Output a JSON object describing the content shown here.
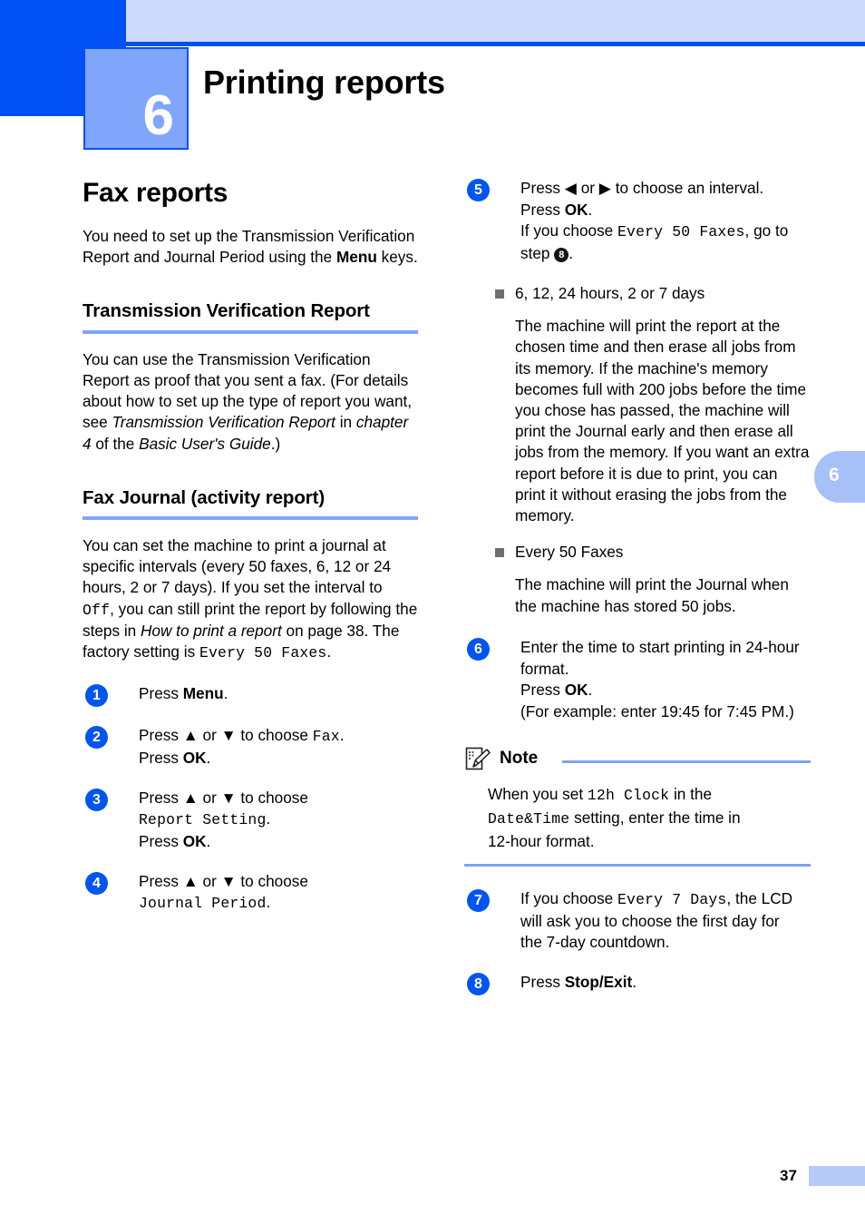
{
  "chapter": {
    "number": "6",
    "title": "Printing reports",
    "edge_tab_number": "6"
  },
  "colors": {
    "header_dark_blue": "#0050f5",
    "header_pale_blue": "#ccdafb",
    "chapter_box_blue": "#80a6fb",
    "rule_blue": "#80a6fb",
    "step_badge_blue": "#0055f0",
    "edge_tab_blue": "#a7c0f7",
    "bullet_gray": "#6e6e6e",
    "footer_block_blue": "#b6cbf8"
  },
  "left_column": {
    "section_title": "Fax reports",
    "intro": {
      "part1": "You need to set up the Transmission Verification Report and Journal Period using the ",
      "bold": "Menu",
      "part2": " keys."
    },
    "sub1_title": "Transmission Verification Report",
    "sub1_body": {
      "part1": "You can use the Transmission Verification Report as proof that you sent a fax. (For details about how to set up the type of report you want, see ",
      "italic1": "Transmission Verification Report",
      "part2": " in ",
      "italic2": "chapter 4",
      "part3": " of the ",
      "italic3": "Basic User's Guide",
      "part4": ".)"
    },
    "sub2_title": "Fax Journal (activity report)",
    "sub2_body": {
      "part1": "You can set the machine to print a journal at specific intervals (every 50 faxes, 6, 12 or 24 hours, 2 or 7 days). If you set the interval to ",
      "mono1": "Off",
      "part2": ", you can still print the report by following the steps in ",
      "italic1": "How to print a report",
      "part3": " on page 38. The factory setting is ",
      "mono2": "Every 50 Faxes",
      "part4": "."
    },
    "steps": [
      {
        "number": "1",
        "lines": [
          {
            "segments": [
              {
                "text": "Press ",
                "style": "normal"
              },
              {
                "text": "Menu",
                "style": "bold"
              },
              {
                "text": ".",
                "style": "normal"
              }
            ]
          }
        ]
      },
      {
        "number": "2",
        "lines": [
          {
            "segments": [
              {
                "text": "Press ",
                "style": "normal"
              },
              {
                "text": "▲",
                "style": "glyph"
              },
              {
                "text": " or ",
                "style": "normal"
              },
              {
                "text": "▼",
                "style": "glyph"
              },
              {
                "text": " to choose ",
                "style": "normal"
              },
              {
                "text": "Fax",
                "style": "mono"
              },
              {
                "text": ".",
                "style": "normal"
              }
            ]
          },
          {
            "segments": [
              {
                "text": "Press ",
                "style": "normal"
              },
              {
                "text": "OK",
                "style": "bold"
              },
              {
                "text": ".",
                "style": "normal"
              }
            ]
          }
        ]
      },
      {
        "number": "3",
        "lines": [
          {
            "segments": [
              {
                "text": "Press ",
                "style": "normal"
              },
              {
                "text": "▲",
                "style": "glyph"
              },
              {
                "text": " or ",
                "style": "normal"
              },
              {
                "text": "▼",
                "style": "glyph"
              },
              {
                "text": " to choose",
                "style": "normal"
              }
            ]
          },
          {
            "segments": [
              {
                "text": "Report Setting",
                "style": "mono"
              },
              {
                "text": ".",
                "style": "normal"
              }
            ]
          },
          {
            "segments": [
              {
                "text": "Press ",
                "style": "normal"
              },
              {
                "text": "OK",
                "style": "bold"
              },
              {
                "text": ".",
                "style": "normal"
              }
            ]
          }
        ]
      },
      {
        "number": "4",
        "lines": [
          {
            "segments": [
              {
                "text": "Press ",
                "style": "normal"
              },
              {
                "text": "▲",
                "style": "glyph"
              },
              {
                "text": " or ",
                "style": "normal"
              },
              {
                "text": "▼",
                "style": "glyph"
              },
              {
                "text": " to choose",
                "style": "normal"
              }
            ]
          },
          {
            "segments": [
              {
                "text": "Journal Period",
                "style": "mono"
              },
              {
                "text": ".",
                "style": "normal"
              }
            ]
          }
        ]
      }
    ]
  },
  "right_column": {
    "step5": {
      "number": "5",
      "lines": [
        {
          "segments": [
            {
              "text": "Press ",
              "style": "normal"
            },
            {
              "text": "◀",
              "style": "glyph"
            },
            {
              "text": " or ",
              "style": "normal"
            },
            {
              "text": "▶",
              "style": "glyph"
            },
            {
              "text": " to choose an interval.",
              "style": "normal"
            }
          ]
        },
        {
          "segments": [
            {
              "text": "Press ",
              "style": "normal"
            },
            {
              "text": "OK",
              "style": "bold"
            },
            {
              "text": ".",
              "style": "normal"
            }
          ]
        },
        {
          "segments": [
            {
              "text": "If you choose ",
              "style": "normal"
            },
            {
              "text": "Every 50 Faxes",
              "style": "mono"
            },
            {
              "text": ", go to",
              "style": "normal"
            }
          ]
        },
        {
          "segments": [
            {
              "text": "step ",
              "style": "normal"
            },
            {
              "text": "8",
              "style": "inline-badge"
            },
            {
              "text": ".",
              "style": "normal"
            }
          ]
        }
      ]
    },
    "bullets": [
      {
        "label": "6, 12, 24 hours, 2 or 7 days",
        "body": "The machine will print the report at the chosen time and then erase all jobs from its memory. If the machine's memory becomes full with 200 jobs before the time you chose has passed, the machine will print the Journal early and then erase all jobs from the memory. If you want an extra report before it is due to print, you can print it without erasing the jobs from the memory."
      },
      {
        "label": "Every 50 Faxes",
        "body": "The machine will print the Journal when the machine has stored 50 jobs."
      }
    ],
    "step6": {
      "number": "6",
      "lines": [
        {
          "segments": [
            {
              "text": "Enter the time to start printing in 24-hour",
              "style": "normal"
            }
          ]
        },
        {
          "segments": [
            {
              "text": "format.",
              "style": "normal"
            }
          ]
        },
        {
          "segments": [
            {
              "text": "Press ",
              "style": "normal"
            },
            {
              "text": "OK",
              "style": "bold"
            },
            {
              "text": ".",
              "style": "normal"
            }
          ]
        },
        {
          "segments": [
            {
              "text": "(For example: enter 19:45 for 7:45 PM.)",
              "style": "normal"
            }
          ]
        }
      ]
    },
    "note": {
      "label": "Note",
      "icon": "note-pencil-icon",
      "lines": [
        {
          "segments": [
            {
              "text": "When you set ",
              "style": "normal"
            },
            {
              "text": "12h Clock",
              "style": "mono"
            },
            {
              "text": " in the",
              "style": "normal"
            }
          ]
        },
        {
          "segments": [
            {
              "text": "Date&Time",
              "style": "mono"
            },
            {
              "text": " setting, enter the time in",
              "style": "normal"
            }
          ]
        },
        {
          "segments": [
            {
              "text": "12-hour format.",
              "style": "normal"
            }
          ]
        }
      ]
    },
    "step7": {
      "number": "7",
      "lines": [
        {
          "segments": [
            {
              "text": "If you choose ",
              "style": "normal"
            },
            {
              "text": "Every 7 Days",
              "style": "mono"
            },
            {
              "text": ", the LCD",
              "style": "normal"
            }
          ]
        },
        {
          "segments": [
            {
              "text": "will ask you to choose the first day for",
              "style": "normal"
            }
          ]
        },
        {
          "segments": [
            {
              "text": "the 7-day countdown.",
              "style": "normal"
            }
          ]
        }
      ]
    },
    "step8": {
      "number": "8",
      "lines": [
        {
          "segments": [
            {
              "text": "Press ",
              "style": "normal"
            },
            {
              "text": "Stop/Exit",
              "style": "bold"
            },
            {
              "text": ".",
              "style": "normal"
            }
          ]
        }
      ]
    }
  },
  "footer": {
    "page_number": "37"
  }
}
